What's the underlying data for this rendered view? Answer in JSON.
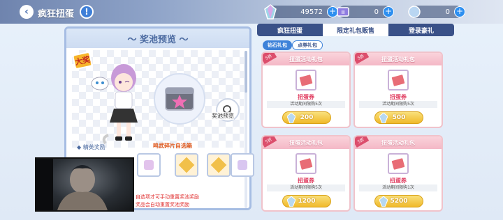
{
  "header": {
    "title": "疯狂扭蛋",
    "back_icon": "‹",
    "help_icon": "!"
  },
  "currencies": [
    {
      "name": "gem",
      "value": "49572"
    },
    {
      "name": "ticket",
      "value": "0"
    },
    {
      "name": "coin",
      "value": "0"
    }
  ],
  "pool": {
    "title": "〜 奖池预览 〜",
    "badge": "大奖",
    "chest_label": "鸣武碎片自选箱",
    "preview_label": "奖池预览",
    "elite_label": "◆ 精英奖励",
    "notes": [
      "自选项才可手动重置奖池奖励",
      "奖品会自动重置奖池奖励"
    ]
  },
  "tabs": [
    {
      "label": "疯狂扭蛋",
      "active": false
    },
    {
      "label": "限定礼包贩售",
      "active": true
    },
    {
      "label": "登录豪礼",
      "active": false
    }
  ],
  "subtabs": [
    {
      "label": "钻石礼包",
      "active": true
    },
    {
      "label": "点券礼包",
      "active": false
    }
  ],
  "cards": [
    {
      "title": "扭蛋活动礼包",
      "ribbon": "5折",
      "item": "扭蛋券",
      "limit": "活动期间限购5次",
      "price": "200"
    },
    {
      "title": "扭蛋活动礼包",
      "ribbon": "5折",
      "item": "扭蛋券",
      "limit": "活动期间限购5次",
      "price": "500"
    },
    {
      "title": "扭蛋活动礼包",
      "ribbon": "5折",
      "item": "扭蛋券",
      "limit": "活动期间限购5次",
      "price": "1200"
    },
    {
      "title": "扭蛋活动礼包",
      "ribbon": "5折",
      "item": "扭蛋券",
      "limit": "活动期间限购1次",
      "price": "5200"
    }
  ],
  "colors": {
    "accent": "#3e82d9",
    "pink": "#f4b8c6",
    "gold": "#f0b92a"
  }
}
